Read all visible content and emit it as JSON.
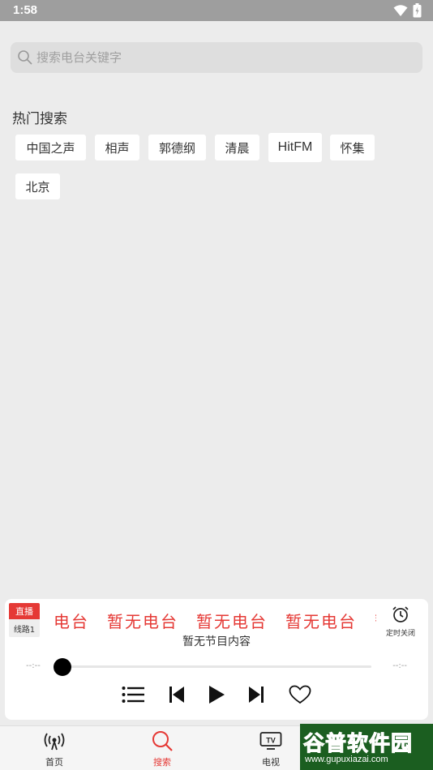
{
  "status_bar": {
    "time": "1:58",
    "icons": [
      "wifi-icon",
      "battery-icon"
    ]
  },
  "search": {
    "placeholder": "搜索电台关键字"
  },
  "hot_search": {
    "title": "热门搜索",
    "tags": [
      "中国之声",
      "相声",
      "郭德纲",
      "清晨",
      "HitFM",
      "怀集",
      "北京"
    ]
  },
  "player": {
    "live_label": "直播",
    "line_label": "线路1",
    "marquee_text": "电台　暂无电台　暂无电台　暂无电台　暂无电台",
    "program_text": "暂无节目内容",
    "timer_label": "定时关闭",
    "time_current": "--:--",
    "time_total": "--:--",
    "progress": 0,
    "controls": [
      "playlist-icon",
      "previous-icon",
      "play-icon",
      "next-icon",
      "favorite-icon"
    ]
  },
  "nav": {
    "items": [
      {
        "label": "首页",
        "icon": "radio-icon"
      },
      {
        "label": "搜索",
        "icon": "search-icon"
      },
      {
        "label": "电视",
        "icon": "tv-icon"
      }
    ],
    "active_color": "#e53935"
  },
  "watermark": {
    "brand": "谷普软件园",
    "url": "www.gupuxiazai.com"
  },
  "colors": {
    "accent": "#e53935",
    "background": "#ececec",
    "status_bar": "#9e9e9e"
  }
}
